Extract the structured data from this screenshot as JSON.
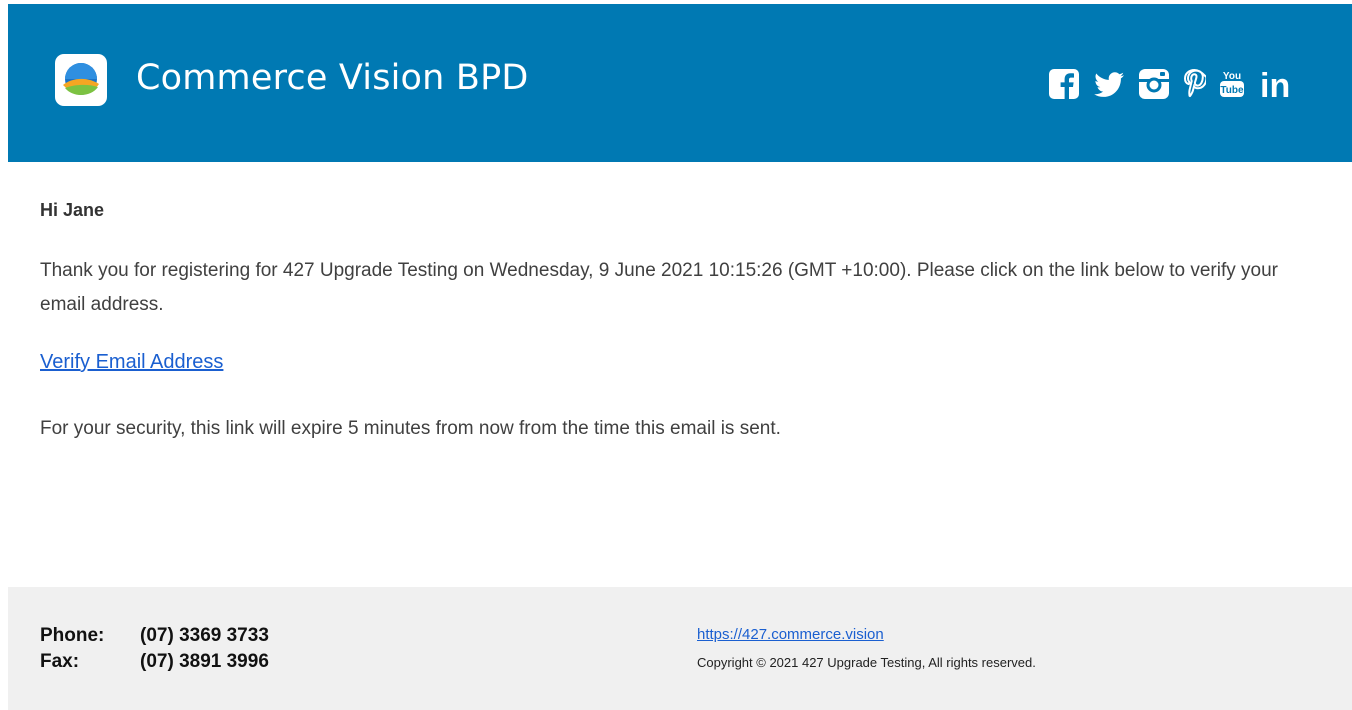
{
  "header": {
    "brand_name": "Commerce Vision BPD",
    "background_color": "#0079b3",
    "socials": [
      {
        "name": "facebook",
        "icon": "facebook-icon"
      },
      {
        "name": "twitter",
        "icon": "twitter-icon"
      },
      {
        "name": "instagram",
        "icon": "instagram-icon"
      },
      {
        "name": "pinterest",
        "icon": "pinterest-icon"
      },
      {
        "name": "youtube",
        "icon": "youtube-icon",
        "text_top": "You",
        "text_bottom": "Tube"
      },
      {
        "name": "linkedin",
        "icon": "linkedin-icon",
        "text": "in"
      }
    ]
  },
  "body": {
    "greeting": "Hi Jane",
    "message_line": "Thank you for registering for 427 Upgrade Testing on Wednesday, 9 June 2021 10:15:26 (GMT +10:00). Please click on the link below to verify your email address.",
    "verify_link": "Verify Email Address",
    "security_note": "For your security, this link will expire 5 minutes from now from the time this email is sent."
  },
  "footer": {
    "phone_label": "Phone:",
    "phone_value": "(07) 3369 3733",
    "fax_label": "Fax:",
    "fax_value": "(07) 3891 3996",
    "website": "https://427.commerce.vision",
    "copyright": "Copyright © 2021 427 Upgrade Testing, All rights reserved."
  }
}
